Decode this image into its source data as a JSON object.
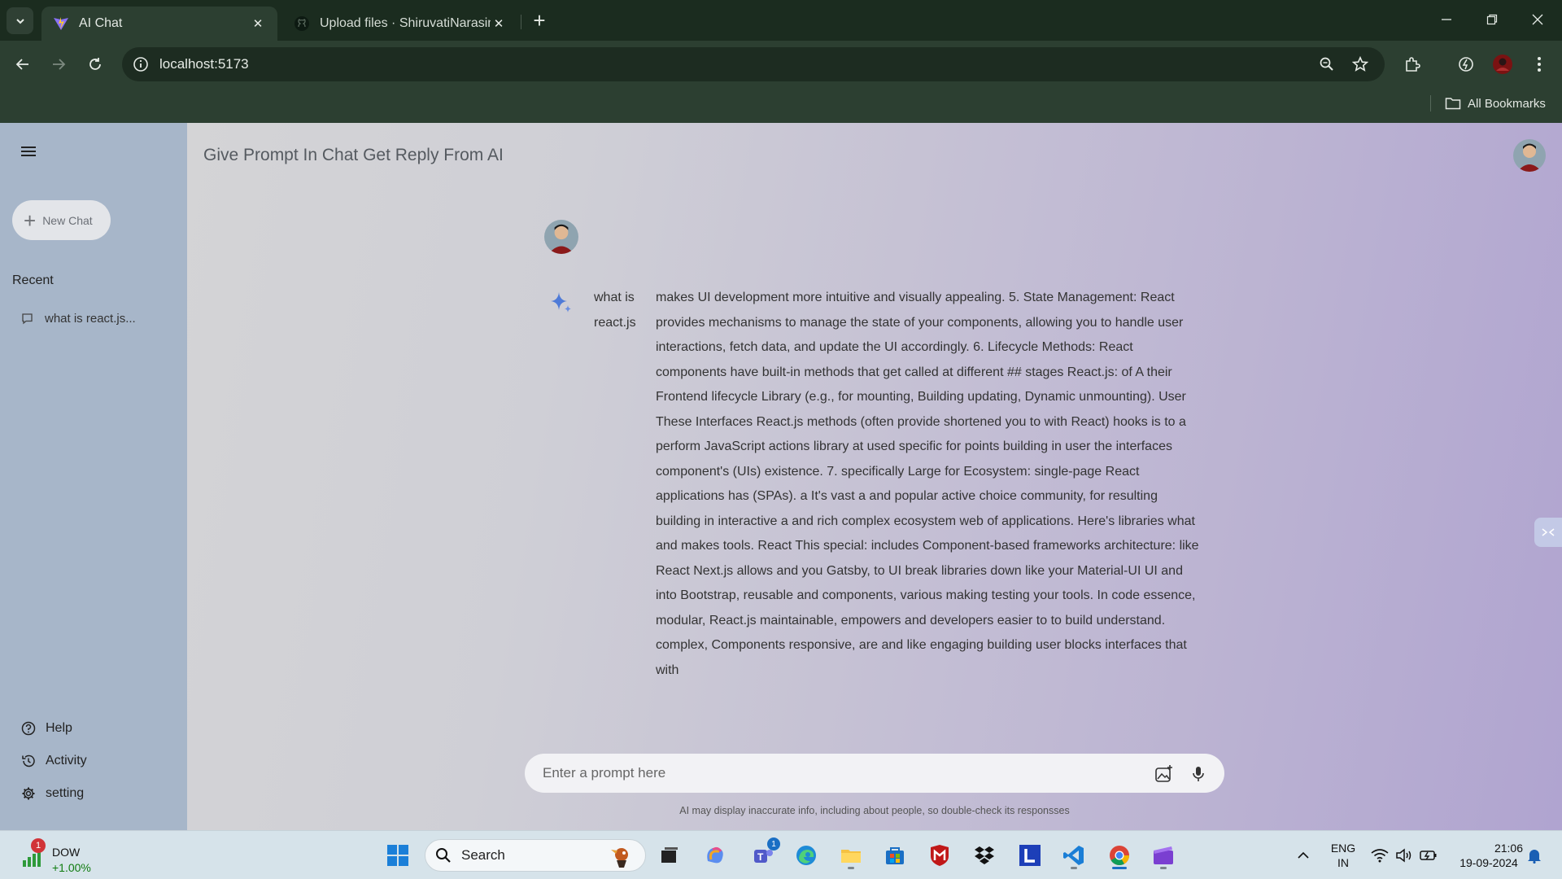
{
  "browser": {
    "tabs": [
      {
        "title": "AI Chat",
        "active": true
      },
      {
        "title": "Upload files · ShiruvatiNarasimh",
        "active": false
      }
    ],
    "url": "localhost:5173",
    "bookmarks_label": "All Bookmarks"
  },
  "app": {
    "title": "Give Prompt In Chat Get Reply From AI",
    "sidebar": {
      "new_chat_label": "New Chat",
      "recent_label": "Recent",
      "recent_items": [
        "what is react.js..."
      ],
      "bottom_items": [
        "Help",
        "Activity",
        "setting"
      ]
    },
    "chat": {
      "prompt": "what is react.js",
      "reply": "makes UI development more intuitive and visually appealing. 5. State Management: React provides mechanisms to manage the state of your components, allowing you to handle user interactions, fetch data, and update the UI accordingly. 6. Lifecycle Methods: React components have built-in methods that get called at different ## stages React.js: of A their Frontend lifecycle Library (e.g., for mounting, Building updating, Dynamic unmounting). User These Interfaces React.js methods (often provide shortened you to with React) hooks is to a perform JavaScript actions library at used specific for points building in user the interfaces component's (UIs) existence. 7. specifically Large for Ecosystem: single-page React applications has (SPAs). a It's vast a and popular active choice community, for resulting building in interactive a and rich complex ecosystem web of applications. Here's libraries what and makes tools. React This special: includes Component-based frameworks architecture: like React Next.js allows and you Gatsby, to UI break libraries down like your Material-UI UI and into Bootstrap, reusable and components, various making testing your tools. In code essence, modular, React.js maintainable, empowers and developers easier to to build understand. complex, Components responsive, are and like engaging building user blocks interfaces that with"
    },
    "input": {
      "placeholder": "Enter a prompt here",
      "value": ""
    },
    "disclaimer": "AI may display inaccurate info, including about people, so double-check its responsses"
  },
  "taskbar": {
    "stock": {
      "name": "DOW",
      "change": "+1.00%",
      "badge": "1"
    },
    "search_label": "Search",
    "teams_badge": "1",
    "language": {
      "line1": "ENG",
      "line2": "IN"
    },
    "time": "21:06",
    "date": "19-09-2024"
  },
  "colors": {
    "chrome_dark": "#1b2c1f",
    "chrome": "#2c3f31",
    "sidebar": "#a7b6c9",
    "accent_gemini": "#4f7bd8"
  }
}
